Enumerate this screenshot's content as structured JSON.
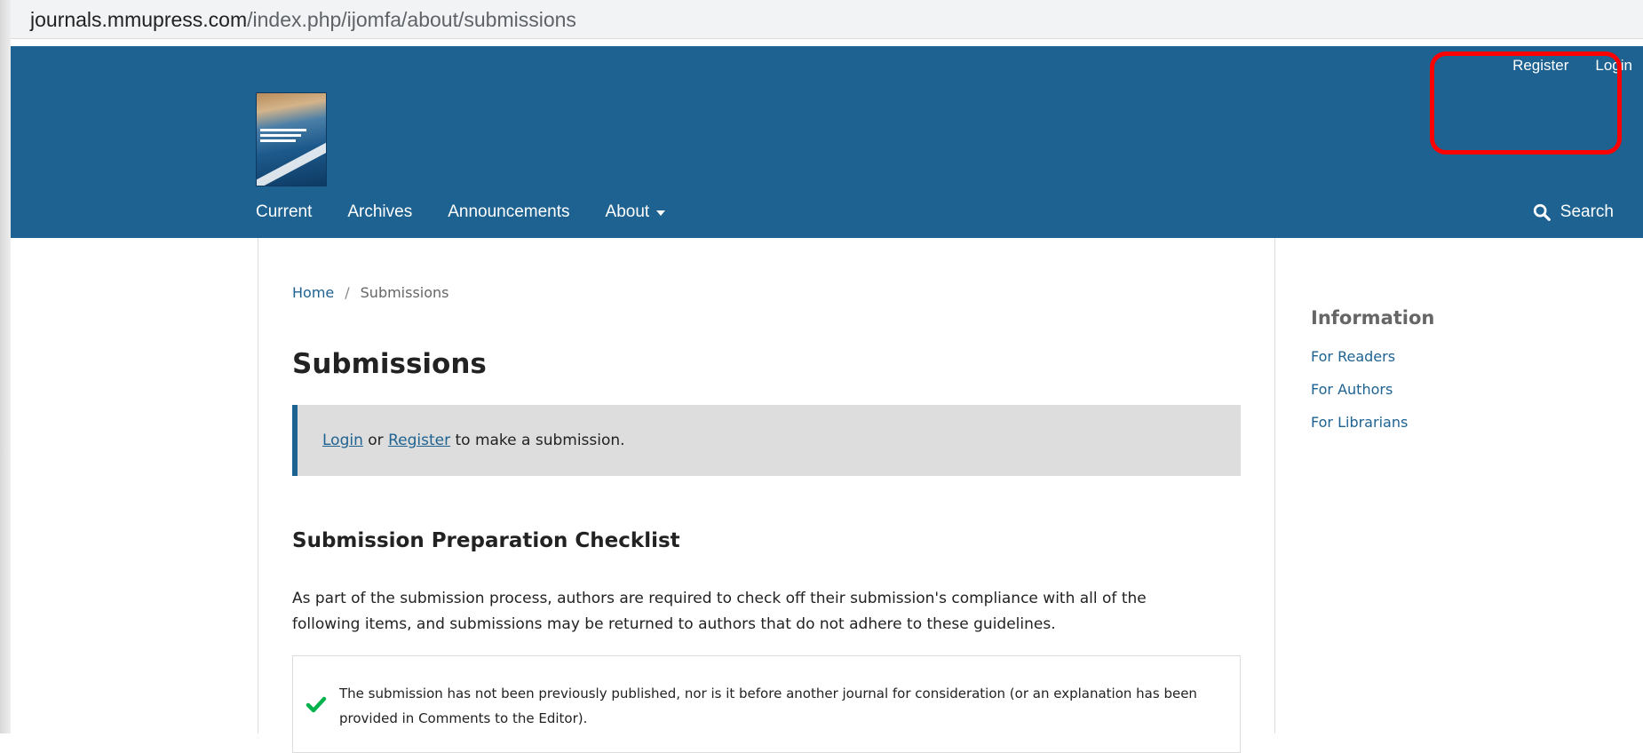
{
  "browser": {
    "url_host": "journals.mmupress.com",
    "url_path": "/index.php/ijomfa/about/submissions"
  },
  "header": {
    "user_nav": {
      "register": "Register",
      "login": "Login"
    },
    "primary_nav": {
      "current": "Current",
      "archives": "Archives",
      "announcements": "Announcements",
      "about": "About"
    },
    "search_label": "Search"
  },
  "breadcrumb": {
    "home": "Home",
    "separator": "/",
    "current": "Submissions"
  },
  "page_title": "Submissions",
  "cta": {
    "login_link": "Login",
    "or_text": " or ",
    "register_link": "Register",
    "suffix": " to make a submission."
  },
  "checklist": {
    "title": "Submission Preparation Checklist",
    "description": "As part of the submission process, authors are required to check off their submission's compliance with all of the following items, and submissions may be returned to authors that do not adhere to these guidelines.",
    "items": [
      {
        "text": "The submission has not been previously published, nor is it before another journal for consideration (or an explanation has been provided in Comments to the Editor)."
      }
    ]
  },
  "sidebar": {
    "title": "Information",
    "links": {
      "readers": "For Readers",
      "authors": "For Authors",
      "librarians": "For Librarians"
    }
  },
  "colors": {
    "brand_blue": "#1e6292",
    "highlight_red": "#ff0000",
    "check_green": "#00b24e"
  },
  "icons": {
    "search": "search-icon",
    "check": "check-icon",
    "caret": "caret-down-icon"
  }
}
